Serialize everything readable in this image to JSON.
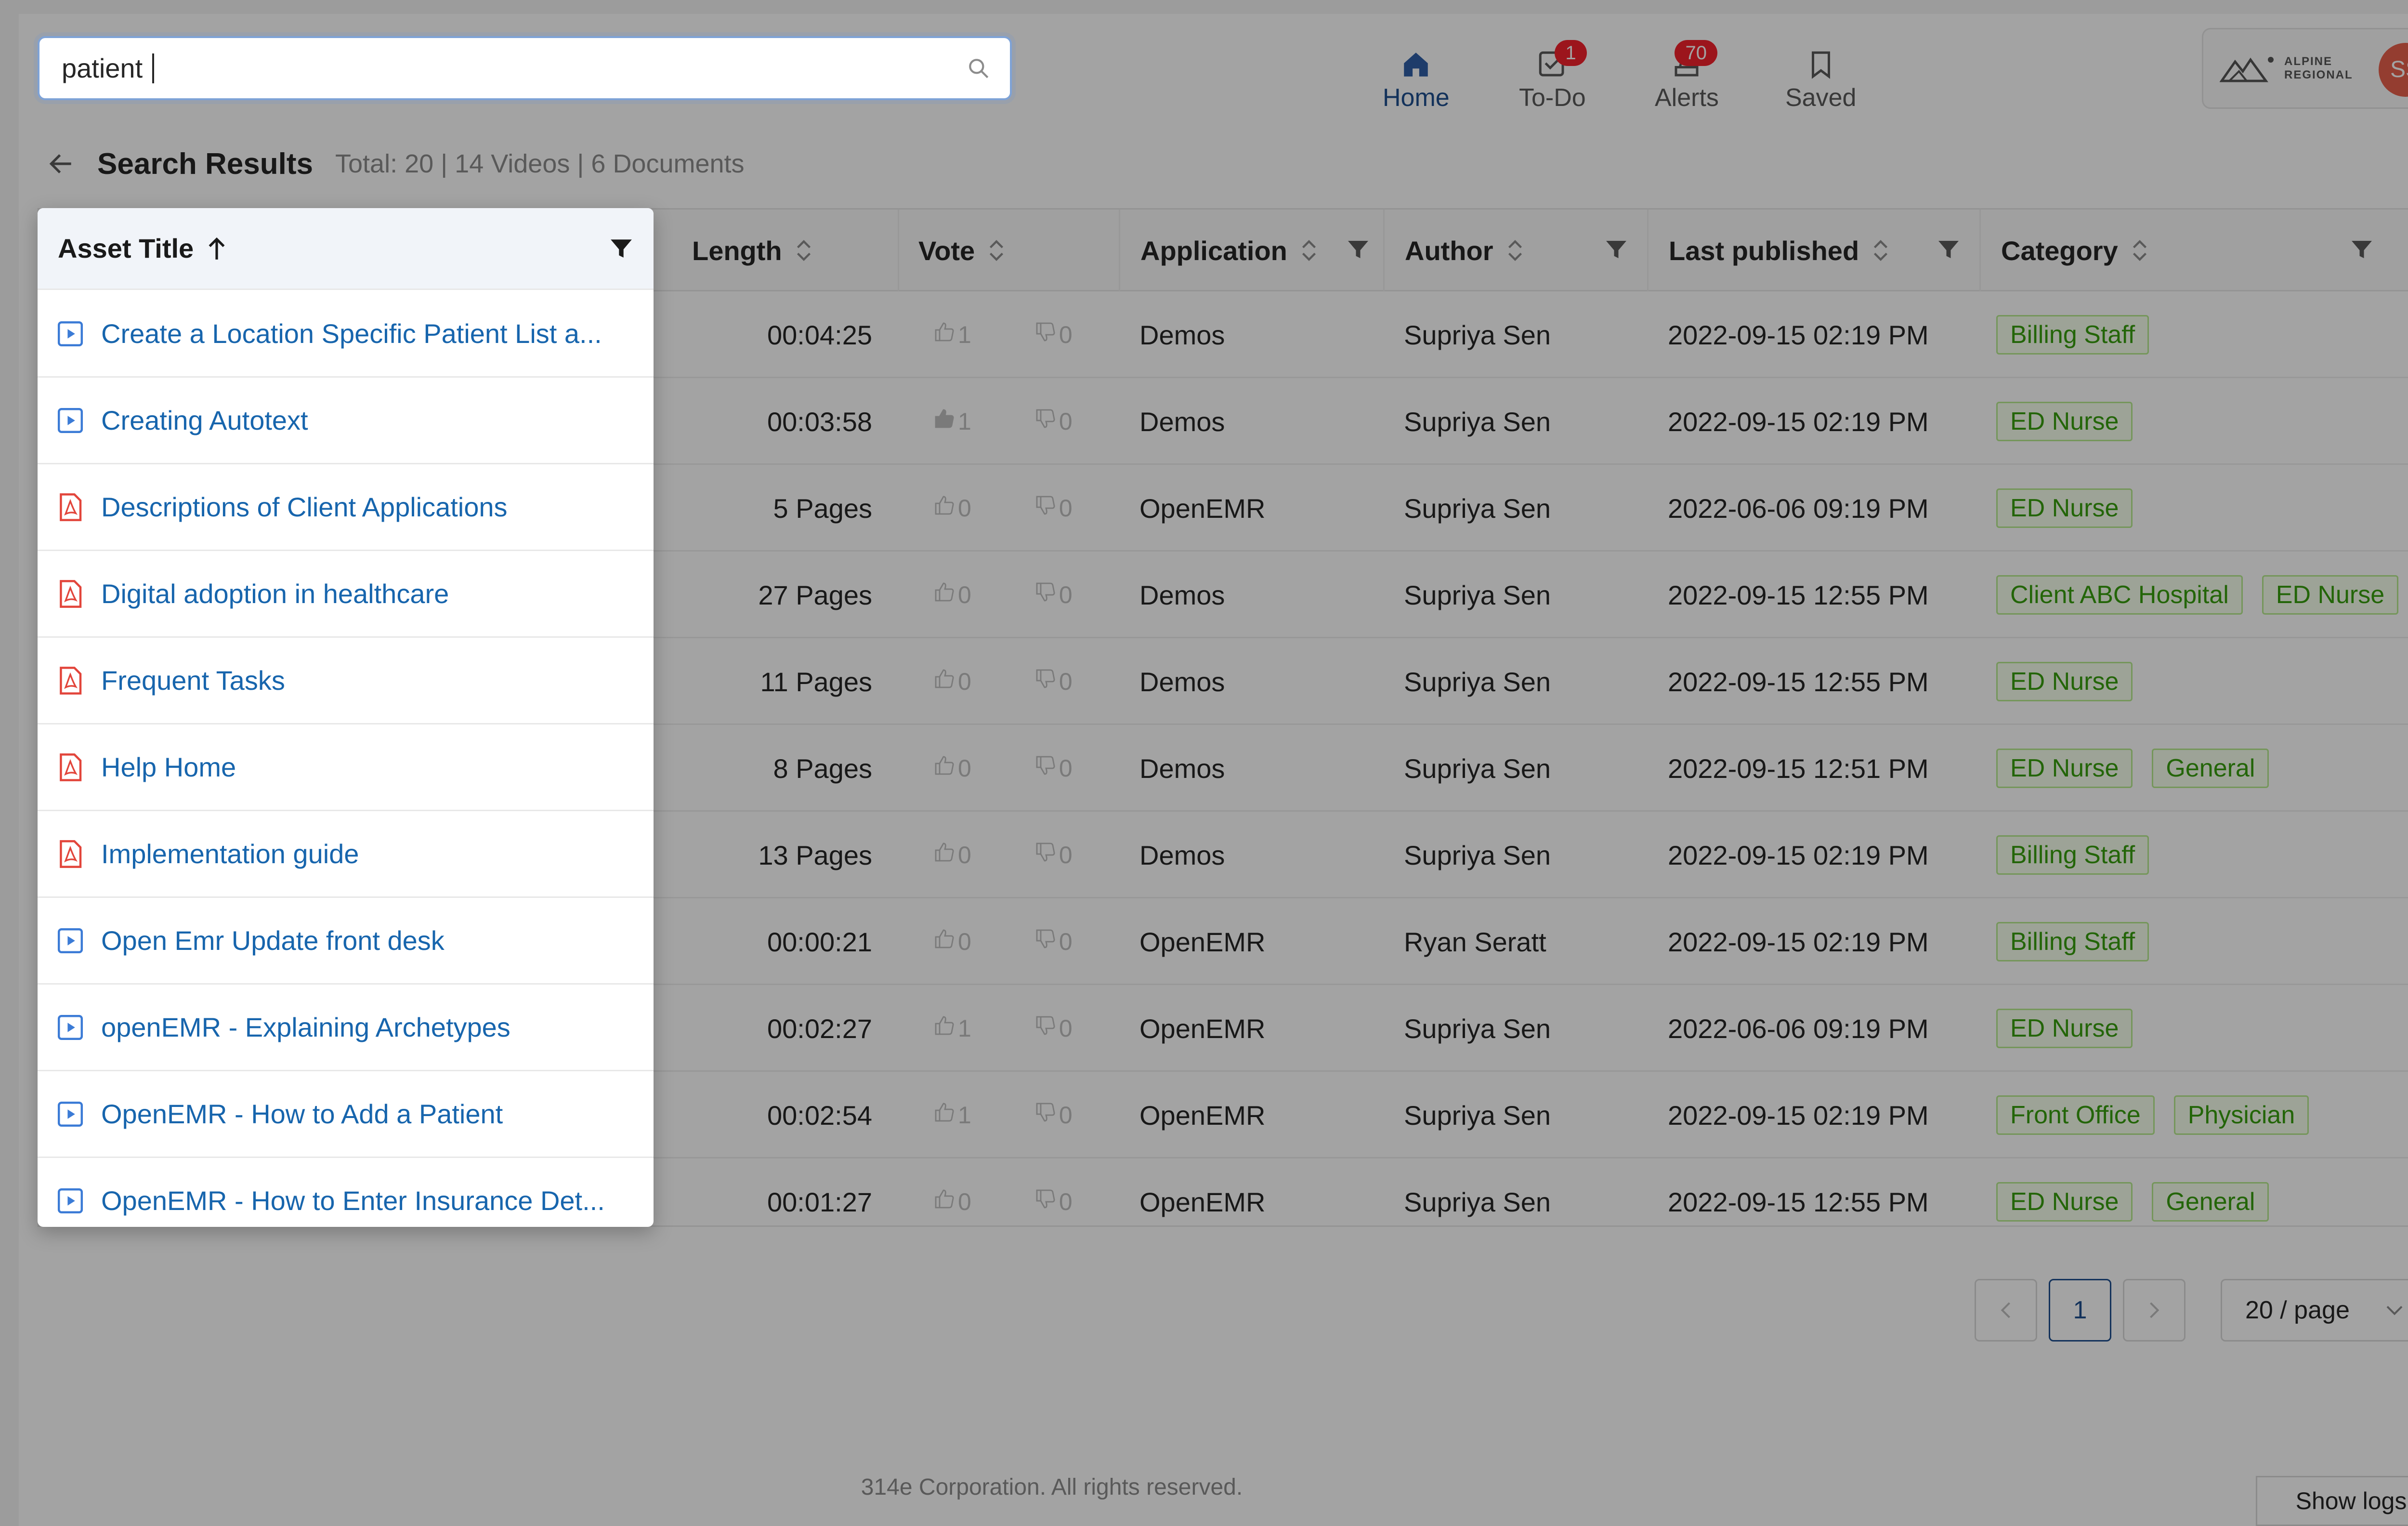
{
  "search": {
    "value": "patient"
  },
  "nav": [
    {
      "label": "Home",
      "icon": "home-icon",
      "badge": ""
    },
    {
      "label": "To-Do",
      "icon": "todo-icon",
      "badge": "1"
    },
    {
      "label": "Alerts",
      "icon": "alert-icon",
      "badge": "70"
    },
    {
      "label": "Saved",
      "icon": "bookmark-icon",
      "badge": ""
    }
  ],
  "org": {
    "name_line1": "ALPINE",
    "name_line2": "REGIONAL",
    "avatar_initials": "SS"
  },
  "results": {
    "title": "Search Results",
    "meta": "Total: 20 | 14 Videos | 6 Documents"
  },
  "table": {
    "columns": {
      "asset_title": "Asset Title",
      "length": "Length",
      "vote": "Vote",
      "application": "Application",
      "author": "Author",
      "last_published": "Last published",
      "category": "Category"
    },
    "rows": [
      {
        "type": "video",
        "title": "Create a Location Specific Patient List a...",
        "length": "00:04:25",
        "up": "1",
        "down": "0",
        "up_active": false,
        "application": "Demos",
        "author": "Supriya Sen",
        "published": "2022-09-15 02:19 PM",
        "categories": [
          "Billing Staff"
        ]
      },
      {
        "type": "video",
        "title": "Creating Autotext",
        "length": "00:03:58",
        "up": "1",
        "down": "0",
        "up_active": true,
        "application": "Demos",
        "author": "Supriya Sen",
        "published": "2022-09-15 02:19 PM",
        "categories": [
          "ED Nurse"
        ]
      },
      {
        "type": "document",
        "title": "Descriptions of Client Applications",
        "length": "5 Pages",
        "up": "0",
        "down": "0",
        "up_active": false,
        "application": "OpenEMR",
        "author": "Supriya Sen",
        "published": "2022-06-06 09:19 PM",
        "categories": [
          "ED Nurse"
        ]
      },
      {
        "type": "document",
        "title": "Digital adoption in healthcare",
        "length": "27 Pages",
        "up": "0",
        "down": "0",
        "up_active": false,
        "application": "Demos",
        "author": "Supriya Sen",
        "published": "2022-09-15 12:55 PM",
        "categories": [
          "Client ABC Hospital",
          "ED Nurse"
        ]
      },
      {
        "type": "document",
        "title": "Frequent Tasks",
        "length": "11 Pages",
        "up": "0",
        "down": "0",
        "up_active": false,
        "application": "Demos",
        "author": "Supriya Sen",
        "published": "2022-09-15 12:55 PM",
        "categories": [
          "ED Nurse"
        ]
      },
      {
        "type": "document",
        "title": "Help Home",
        "length": "8 Pages",
        "up": "0",
        "down": "0",
        "up_active": false,
        "application": "Demos",
        "author": "Supriya Sen",
        "published": "2022-09-15 12:51 PM",
        "categories": [
          "ED Nurse",
          "General"
        ]
      },
      {
        "type": "document",
        "title": "Implementation guide",
        "length": "13 Pages",
        "up": "0",
        "down": "0",
        "up_active": false,
        "application": "Demos",
        "author": "Supriya Sen",
        "published": "2022-09-15 02:19 PM",
        "categories": [
          "Billing Staff"
        ]
      },
      {
        "type": "video",
        "title": "Open Emr Update front desk",
        "length": "00:00:21",
        "up": "0",
        "down": "0",
        "up_active": false,
        "application": "OpenEMR",
        "author": "Ryan Seratt",
        "published": "2022-09-15 02:19 PM",
        "categories": [
          "Billing Staff"
        ]
      },
      {
        "type": "video",
        "title": "openEMR - Explaining Archetypes",
        "length": "00:02:27",
        "up": "1",
        "down": "0",
        "up_active": false,
        "application": "OpenEMR",
        "author": "Supriya Sen",
        "published": "2022-06-06 09:19 PM",
        "categories": [
          "ED Nurse"
        ]
      },
      {
        "type": "video",
        "title": "OpenEMR - How to Add a Patient",
        "length": "00:02:54",
        "up": "1",
        "down": "0",
        "up_active": false,
        "application": "OpenEMR",
        "author": "Supriya Sen",
        "published": "2022-09-15 02:19 PM",
        "categories": [
          "Front Office",
          "Physician"
        ]
      },
      {
        "type": "video",
        "title": "OpenEMR - How to Enter Insurance Det...",
        "length": "00:01:27",
        "up": "0",
        "down": "0",
        "up_active": false,
        "application": "OpenEMR",
        "author": "Supriya Sen",
        "published": "2022-09-15 12:55 PM",
        "categories": [
          "ED Nurse",
          "General"
        ]
      }
    ]
  },
  "pagination": {
    "current": "1",
    "page_size": "20 / page"
  },
  "footer": {
    "copyright": "314e Corporation. All rights reserved.",
    "show_logs": "Show logs"
  },
  "colors": {
    "link": "#1765ad",
    "tag_green": "#389e0d",
    "pdf_red": "#e2453b",
    "video_blue": "#3b7bd6",
    "badge_red": "#f5222d"
  }
}
